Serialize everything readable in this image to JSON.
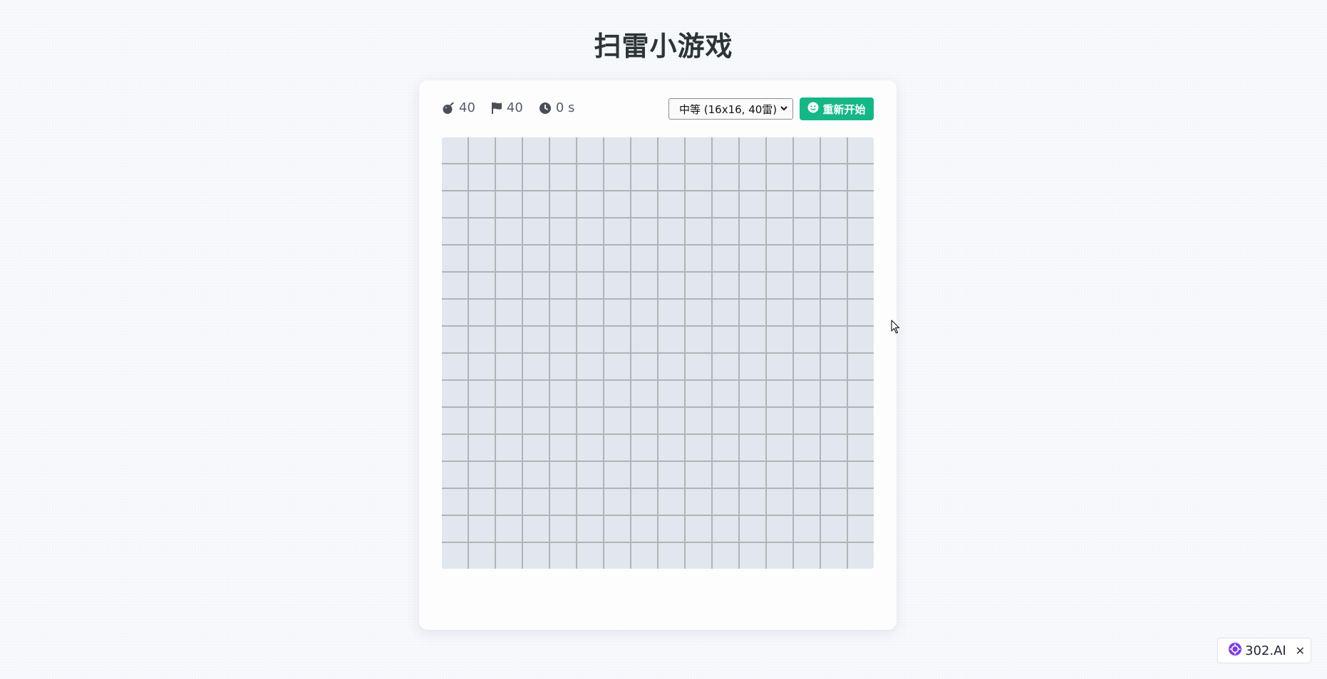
{
  "page": {
    "title": "扫雷小游戏"
  },
  "stats": {
    "mines": "40",
    "flags": "40",
    "time": "0 s"
  },
  "controls": {
    "difficulty_selected": "中等 (16x16, 40雷)",
    "restart_label": "重新开始"
  },
  "board": {
    "rows": 16,
    "cols": 16
  },
  "badge": {
    "brand": "302.AI",
    "close": "✕"
  },
  "colors": {
    "accent": "#12b886",
    "cell": "#e2e6ee",
    "grid": "#aeb6b4",
    "brand": "#7c3aed"
  },
  "icons": {
    "mines": "bomb-icon",
    "flags": "flag-icon",
    "time": "clock-icon",
    "restart": "smile-icon",
    "brand": "302ai-logo-icon"
  }
}
